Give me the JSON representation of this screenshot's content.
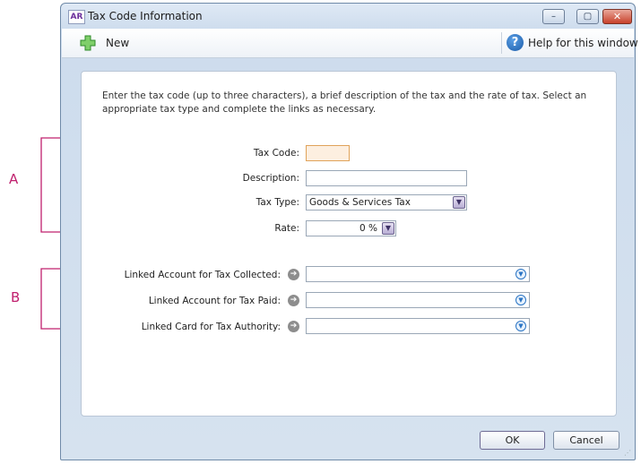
{
  "window": {
    "badge": "AR",
    "title": "Tax Code Information",
    "controls": {
      "minimize": "–",
      "maximize": "▢",
      "close": "✕"
    }
  },
  "toolbar": {
    "new_label": "New",
    "help_label": "Help for this window"
  },
  "form": {
    "intro": "Enter the tax code (up to three characters), a brief description of the tax and the rate of tax. Select an appropriate tax type and complete the links as necessary.",
    "tax_code": {
      "label": "Tax Code:",
      "value": ""
    },
    "description": {
      "label": "Description:",
      "value": ""
    },
    "tax_type": {
      "label": "Tax Type:",
      "value": "Goods & Services Tax"
    },
    "rate": {
      "label": "Rate:",
      "value": "0 %"
    },
    "linked_collected": {
      "label": "Linked Account for Tax Collected:",
      "value": ""
    },
    "linked_paid": {
      "label": "Linked Account for Tax Paid:",
      "value": ""
    },
    "linked_authority": {
      "label": "Linked Card for Tax Authority:",
      "value": ""
    }
  },
  "buttons": {
    "ok": "OK",
    "cancel": "Cancel"
  },
  "callouts": {
    "a": "A",
    "b": "B",
    "color": "#c0206e"
  }
}
